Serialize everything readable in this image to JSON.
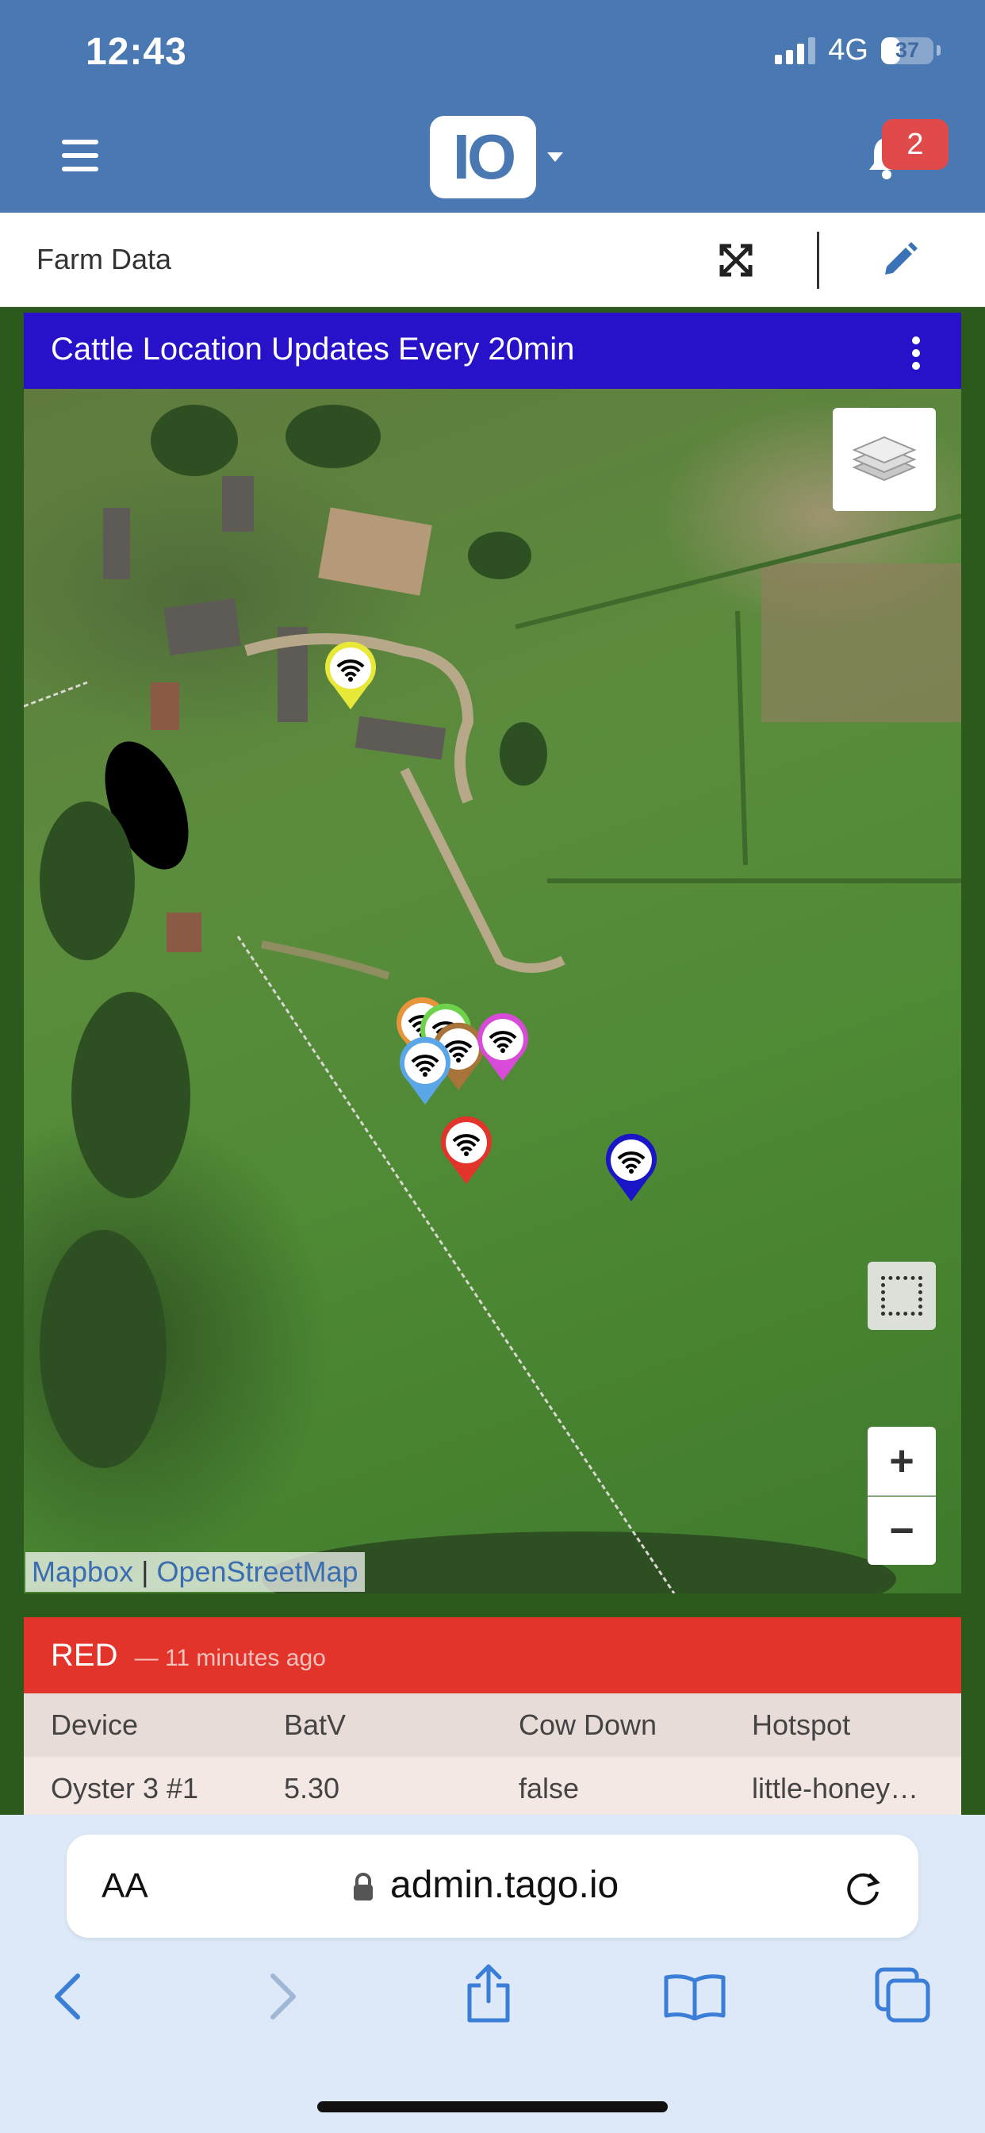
{
  "status_bar": {
    "time": "12:43",
    "network": "4G",
    "battery": "37"
  },
  "header": {
    "logo_text": "IO",
    "notification_count": "2"
  },
  "dashboard": {
    "title": "Farm Data"
  },
  "map_widget": {
    "title": "Cattle Location Updates Every 20min",
    "attribution": {
      "mapbox": "Mapbox",
      "separator": "|",
      "osm": "OpenStreetMap"
    },
    "zoom_in": "+",
    "zoom_out": "−",
    "pin_colors": [
      "#e8e838",
      "#e8943a",
      "#6ed24a",
      "#a8743a",
      "#d84ad8",
      "#5aa6e6",
      "#e2342a",
      "#1a16c8"
    ]
  },
  "table_widget": {
    "title": "RED",
    "time": "— 11 minutes ago",
    "columns": [
      "Device",
      "BatV",
      "Cow Down",
      "Hotspot"
    ],
    "rows": [
      [
        "Oyster 3 #1",
        "5.30",
        "false",
        "little-honey…"
      ]
    ]
  },
  "browser": {
    "font_size_label": "AA",
    "url": "admin.tago.io"
  },
  "colors": {
    "header_blue": "#4a78b2",
    "map_header": "#2712c9",
    "table_header": "#e2342a",
    "badge_red": "#e04a4a"
  }
}
